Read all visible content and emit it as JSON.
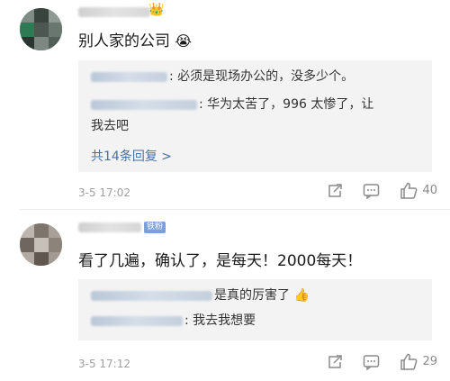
{
  "comments": [
    {
      "text": "别人家的公司",
      "text_emoji": "😭",
      "replies": [
        {
          "text": ": 必须是现场办公的，没多少个。"
        },
        {
          "text": ": 华为太苦了，996 太惨了，让",
          "text_cont": "我去吧"
        }
      ],
      "more_replies": "共14条回复 >",
      "time": "3-5 17:02",
      "like_count": "40"
    },
    {
      "badge": "铁粉",
      "text": "看了几遍，确认了，是每天！2000每天！",
      "replies": [
        {
          "text": "是真的厉害了",
          "emoji": "👍"
        },
        {
          "text": ": 我去我想要"
        }
      ],
      "time": "3-5 17:12",
      "like_count": "29"
    }
  ],
  "icons": {
    "share": "share-icon",
    "comment": "comment-icon",
    "like": "thumbs-up-icon"
  },
  "colors": {
    "link": "#4a6fa5",
    "reply_bg": "#f3f3f3",
    "meta": "#a0a0a0"
  }
}
